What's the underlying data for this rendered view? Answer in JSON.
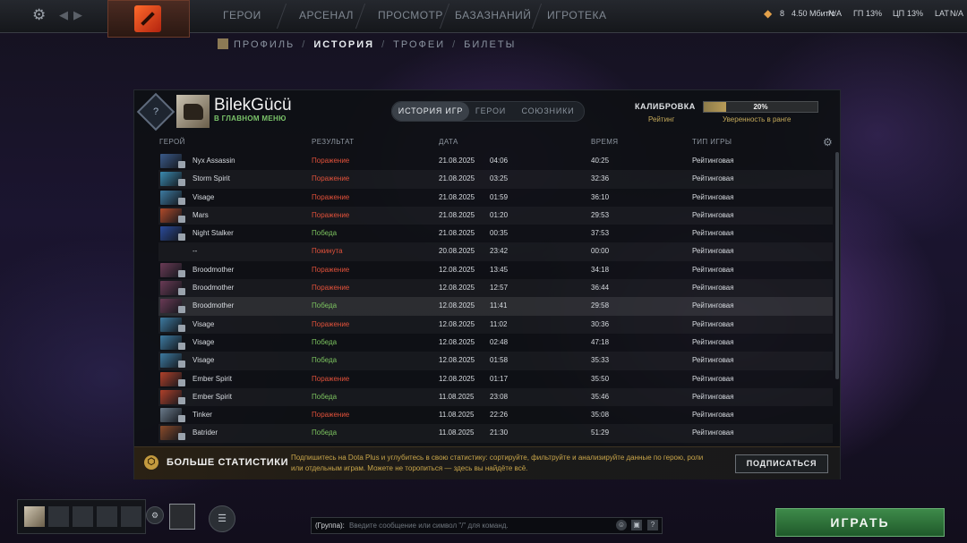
{
  "topbar": {
    "nav": [
      "ГЕРОИ",
      "АРСЕНАЛ",
      "ПРОСМОТР",
      "БАЗАЗНАНИЙ",
      "ИГРОТЕКА"
    ],
    "shards": "8",
    "bandwidth": "4.50",
    "bandwidth_unit": "Мбит/с",
    "na1": "N/A",
    "gp_label": "ГП",
    "gp_value": "13%",
    "cp_label": "ЦП",
    "cp_value": "13%",
    "lat_label": "LAT",
    "lat_value": "N/A"
  },
  "breadcrumb": {
    "items": [
      "ПРОФИЛЬ",
      "ИСТОРИЯ",
      "ТРОФЕИ",
      "БИЛЕТЫ"
    ],
    "sep": "/"
  },
  "profile": {
    "rank": "?",
    "name": "BilekGücü",
    "status": "В ГЛАВНОМ МЕНЮ"
  },
  "tabs": [
    "ИСТОРИЯ ИГР",
    "ГЕРОИ",
    "СОЮЗНИКИ"
  ],
  "calibration": {
    "title": "КАЛИБРОВКА",
    "rating_label": "Рейтинг",
    "progress_label": "20%",
    "progress": 0.2,
    "confidence_label": "Уверенность в ранге"
  },
  "table": {
    "headers": [
      "ГЕРОЙ",
      "РЕЗУЛЬТАТ",
      "ДАТА",
      "ВРЕМЯ",
      "ТИП ИГРЫ"
    ],
    "rows": [
      {
        "hero": "Nyx Assassin",
        "result": "Поражение",
        "res": "loss",
        "date": "21.08.2025",
        "time": "04:06",
        "dur": "40:25",
        "type": "Рейтинговая",
        "color": "#3a5a8a"
      },
      {
        "hero": "Storm Spirit",
        "result": "Поражение",
        "res": "loss",
        "date": "21.08.2025",
        "time": "03:25",
        "dur": "32:36",
        "type": "Рейтинговая",
        "color": "#3a8ab0"
      },
      {
        "hero": "Visage",
        "result": "Поражение",
        "res": "loss",
        "date": "21.08.2025",
        "time": "01:59",
        "dur": "36:10",
        "type": "Рейтинговая",
        "color": "#3d7aa0"
      },
      {
        "hero": "Mars",
        "result": "Поражение",
        "res": "loss",
        "date": "21.08.2025",
        "time": "01:20",
        "dur": "29:53",
        "type": "Рейтинговая",
        "color": "#b04a2a"
      },
      {
        "hero": "Night Stalker",
        "result": "Победа",
        "res": "win",
        "date": "21.08.2025",
        "time": "00:35",
        "dur": "37:53",
        "type": "Рейтинговая",
        "color": "#2a4a9a"
      },
      {
        "hero": "--",
        "result": "Покинута",
        "res": "aband",
        "date": "20.08.2025",
        "time": "23:42",
        "dur": "00:00",
        "type": "Рейтинговая",
        "color": ""
      },
      {
        "hero": "Broodmother",
        "result": "Поражение",
        "res": "loss",
        "date": "12.08.2025",
        "time": "13:45",
        "dur": "34:18",
        "type": "Рейтинговая",
        "color": "#6a3a55"
      },
      {
        "hero": "Broodmother",
        "result": "Поражение",
        "res": "loss",
        "date": "12.08.2025",
        "time": "12:57",
        "dur": "36:44",
        "type": "Рейтинговая",
        "color": "#6a3a55"
      },
      {
        "hero": "Broodmother",
        "result": "Победа",
        "res": "win",
        "date": "12.08.2025",
        "time": "11:41",
        "dur": "29:58",
        "type": "Рейтинговая",
        "color": "#6a3a55"
      },
      {
        "hero": "Visage",
        "result": "Поражение",
        "res": "loss",
        "date": "12.08.2025",
        "time": "11:02",
        "dur": "30:36",
        "type": "Рейтинговая",
        "color": "#3d7aa0"
      },
      {
        "hero": "Visage",
        "result": "Победа",
        "res": "win",
        "date": "12.08.2025",
        "time": "02:48",
        "dur": "47:18",
        "type": "Рейтинговая",
        "color": "#3d7aa0"
      },
      {
        "hero": "Visage",
        "result": "Победа",
        "res": "win",
        "date": "12.08.2025",
        "time": "01:58",
        "dur": "35:33",
        "type": "Рейтинговая",
        "color": "#3d7aa0"
      },
      {
        "hero": "Ember Spirit",
        "result": "Поражение",
        "res": "loss",
        "date": "12.08.2025",
        "time": "01:17",
        "dur": "35:50",
        "type": "Рейтинговая",
        "color": "#b0402a"
      },
      {
        "hero": "Ember Spirit",
        "result": "Победа",
        "res": "win",
        "date": "11.08.2025",
        "time": "23:08",
        "dur": "35:46",
        "type": "Рейтинговая",
        "color": "#b0402a"
      },
      {
        "hero": "Tinker",
        "result": "Поражение",
        "res": "loss",
        "date": "11.08.2025",
        "time": "22:26",
        "dur": "35:08",
        "type": "Рейтинговая",
        "color": "#6a7a8a"
      },
      {
        "hero": "Batrider",
        "result": "Победа",
        "res": "win",
        "date": "11.08.2025",
        "time": "21:30",
        "dur": "51:29",
        "type": "Рейтинговая",
        "color": "#8a4a2a"
      }
    ]
  },
  "plus": {
    "title": "БОЛЬШЕ СТАТИСТИКИ",
    "text": "Подпишитесь на Dota Plus и углубитесь в свою статистику: сортируйте, фильтруйте и анализируйте данные по герою, роли или отдельным играм. Можете не торопиться — здесь вы найдёте всё.",
    "button": "ПОДПИСАТЬСЯ"
  },
  "chat": {
    "channel": "(Группа):",
    "placeholder": "Введите сообщение или символ \"/\" для команд."
  },
  "play_button": "ИГРАТЬ"
}
